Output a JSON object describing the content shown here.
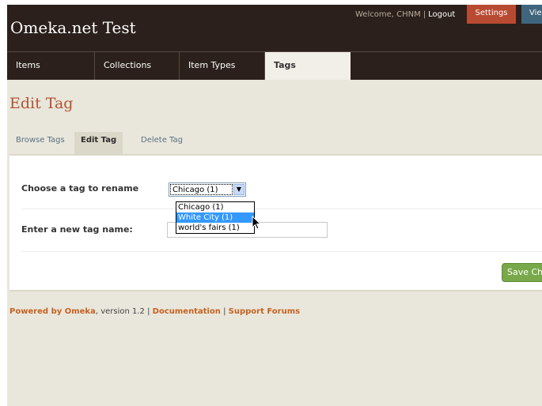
{
  "header": {
    "site_title": "Omeka.net Test",
    "welcome": "Welcome, CHNM",
    "separator": "|",
    "logout": "Logout",
    "settings": "Settings",
    "view": "Vie"
  },
  "primary_nav": {
    "tabs": [
      {
        "label": "Items",
        "active": false
      },
      {
        "label": "Collections",
        "active": false
      },
      {
        "label": "Item Types",
        "active": false
      },
      {
        "label": "Tags",
        "active": true
      }
    ]
  },
  "page": {
    "title": "Edit Tag"
  },
  "sub_nav": {
    "tabs": [
      {
        "label": "Browse Tags",
        "active": false
      },
      {
        "label": "Edit Tag",
        "active": true
      },
      {
        "label": "Delete Tag",
        "active": false
      }
    ]
  },
  "form": {
    "choose_label": "Choose a tag to rename",
    "selected_tag": "Chicago (1)",
    "options": [
      "Chicago (1)",
      "White City (1)",
      "world's fairs (1)"
    ],
    "highlighted_option": "White City (1)",
    "new_name_label": "Enter a new tag name:",
    "new_name_value": "",
    "save_label": "Save Cha"
  },
  "footer": {
    "powered_by": "Powered by Omeka",
    "version": ", version 1.2 |",
    "documentation": "Documentation",
    "sep": "|",
    "support": "Support Forums"
  },
  "colors": {
    "header_bg": "#2b201b",
    "title": "#b0532f",
    "settings_bg": "#b94a32",
    "save_bg": "#79a84a",
    "link": "#c4621f"
  }
}
